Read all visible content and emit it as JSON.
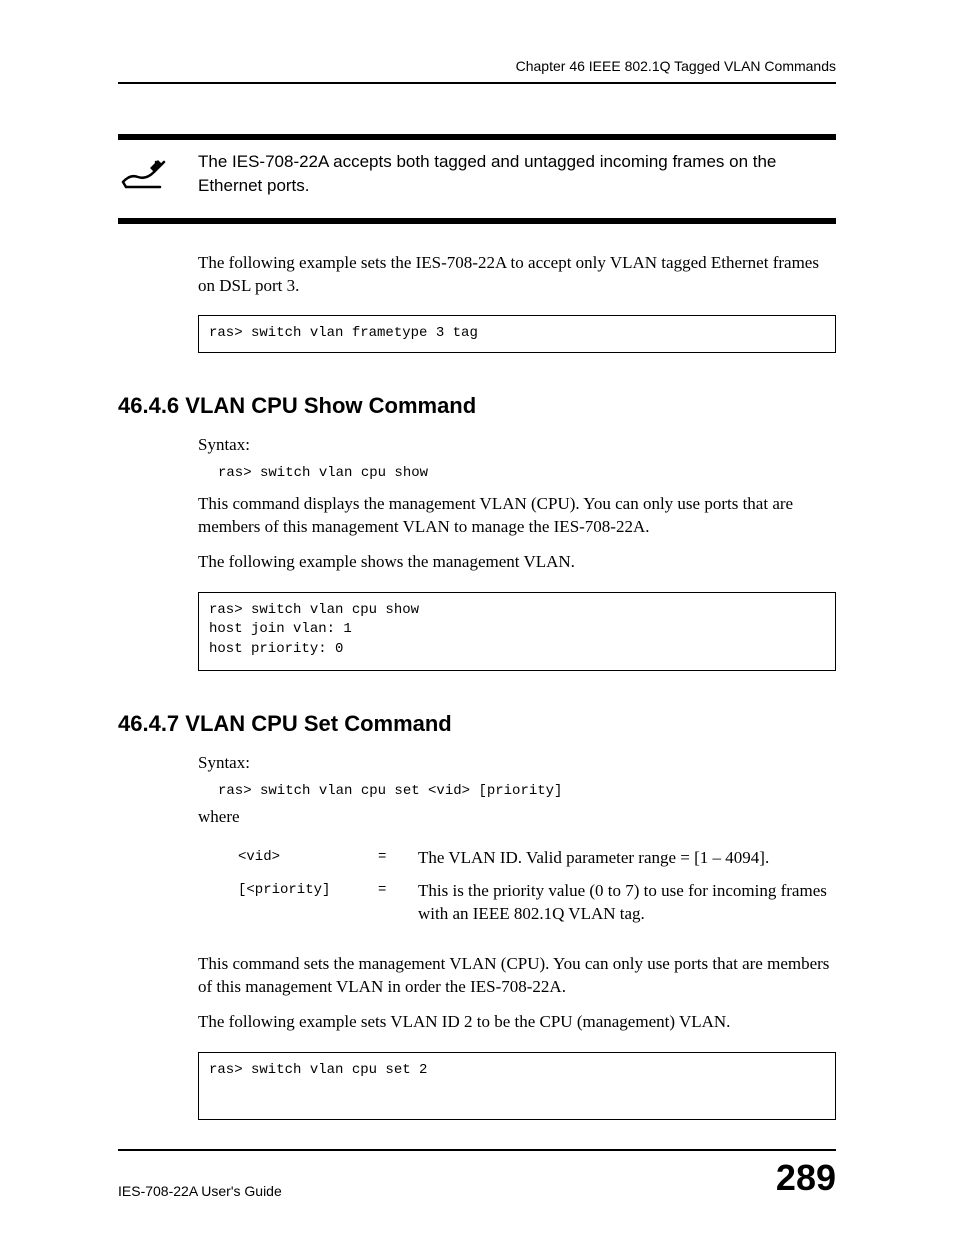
{
  "header": "Chapter 46 IEEE 802.1Q Tagged VLAN Commands",
  "note": "The IES-708-22A accepts both tagged and untagged incoming frames on the Ethernet ports.",
  "intro_para": "The following example sets the IES-708-22A to accept only VLAN tagged Ethernet frames on DSL port 3.",
  "code1": "ras> switch vlan frametype 3 tag",
  "section_646": {
    "heading": "46.4.6  VLAN CPU Show Command",
    "syntax_label": "Syntax:",
    "syntax_code": "ras> switch vlan cpu show",
    "desc1": "This command displays the management VLAN (CPU). You can only use ports that are members of this management VLAN to manage the IES-708-22A.",
    "desc2": "The following example shows the management VLAN.",
    "code": "ras> switch vlan cpu show\nhost join vlan: 1\nhost priority: 0"
  },
  "section_647": {
    "heading": "46.4.7  VLAN CPU Set Command",
    "syntax_label": "Syntax:",
    "syntax_code": "ras> switch vlan cpu set <vid> [priority]",
    "where": "where",
    "params": [
      {
        "name": "<vid>",
        "eq": "=",
        "desc": "The VLAN ID. Valid parameter range = [1 – 4094]."
      },
      {
        "name": "[<priority]",
        "eq": "=",
        "desc": "This is the priority value (0 to 7) to use for incoming frames with an IEEE 802.1Q VLAN tag."
      }
    ],
    "desc1": "This command sets the management VLAN (CPU). You can only use ports that are members of this management VLAN in order the IES-708-22A.",
    "desc2": "The following example sets VLAN ID 2 to be the CPU (management) VLAN.",
    "code": "ras> switch vlan cpu set 2"
  },
  "footer_title": "IES-708-22A User's Guide",
  "page_number": "289"
}
